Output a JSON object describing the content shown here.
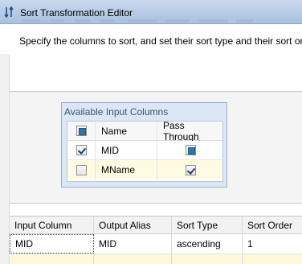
{
  "window": {
    "title": "Sort Transformation Editor",
    "title_icon": "sort-arrows-icon"
  },
  "description": "Specify the columns to sort, and set their sort type and their sort ord",
  "available_input_columns": {
    "title": "Available Input Columns",
    "headers": {
      "select": "",
      "name": "Name",
      "pass_through": "Pass Through"
    },
    "rows": [
      {
        "selected": true,
        "name": "MID",
        "pass_through": "mixed"
      },
      {
        "selected": false,
        "name": "MName",
        "pass_through": "checked"
      }
    ]
  },
  "sort_grid": {
    "headers": [
      "Input Column",
      "Output Alias",
      "Sort Type",
      "Sort Order"
    ],
    "rows": [
      {
        "input_column": "MID",
        "output_alias": "MID",
        "sort_type": "ascending",
        "sort_order": "1"
      }
    ]
  },
  "colors": {
    "titlebar": "#b6cbe6",
    "panel_header": "#dce7f5",
    "selected_row": "#fffbe3",
    "checkbox_fill": "#2d77a8"
  }
}
